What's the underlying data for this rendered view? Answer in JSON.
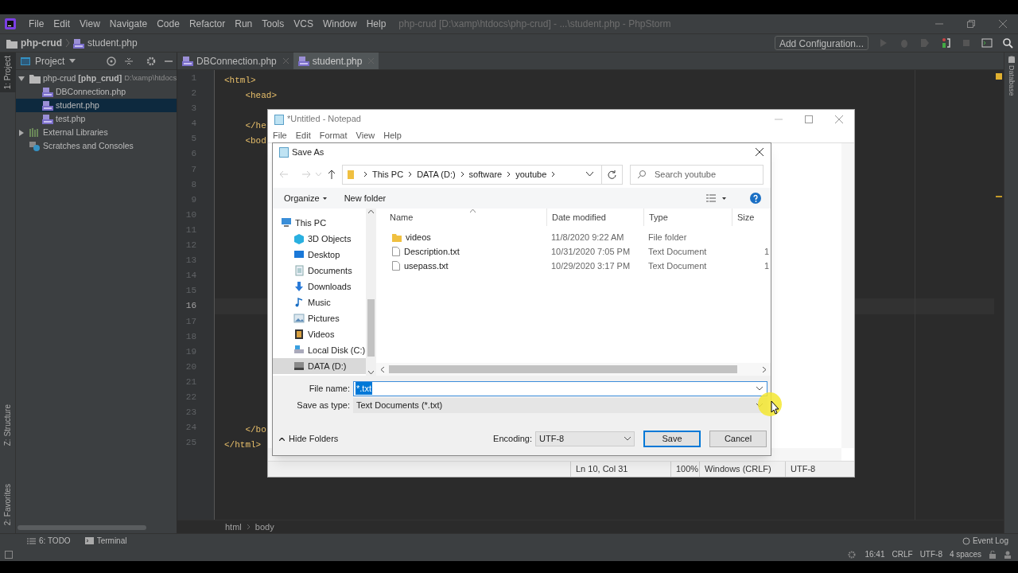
{
  "ide": {
    "menu": [
      "File",
      "Edit",
      "View",
      "Navigate",
      "Code",
      "Refactor",
      "Run",
      "Tools",
      "VCS",
      "Window",
      "Help"
    ],
    "title": "php-crud [D:\\xamp\\htdocs\\php-crud] - ...\\student.php - PhpStorm",
    "breadcrumb": [
      "php-crud",
      "student.php"
    ],
    "run_config": "Add Configuration...",
    "left_tabs": [
      {
        "label": "1: Project",
        "selected": true
      },
      {
        "label": "Z: Structure",
        "selected": false
      },
      {
        "label": "2: Favorites",
        "selected": false
      }
    ],
    "right_tab": "Database",
    "project_header": "Project",
    "tree": [
      {
        "kind": "module",
        "label": "php-crud **[php_crud]**",
        "path": "D:\\xamp\\htdocs",
        "expanded": true,
        "selected": false,
        "children": [
          {
            "kind": "php",
            "label": "DBConnection.php",
            "selected": false
          },
          {
            "kind": "php",
            "label": "student.php",
            "selected": true
          },
          {
            "kind": "php",
            "label": "test.php",
            "selected": false
          }
        ]
      },
      {
        "kind": "libraries",
        "label": "External Libraries",
        "expanded": false,
        "selected": false
      },
      {
        "kind": "scratches",
        "label": "Scratches and Consoles",
        "selected": false
      }
    ],
    "editor_tabs": [
      {
        "label": "DBConnection.php",
        "selected": false
      },
      {
        "label": "student.php",
        "selected": true
      }
    ],
    "lines": [
      {
        "number": "1",
        "code": "<html>",
        "current": false
      },
      {
        "number": "2",
        "code": "    <head>",
        "current": false
      },
      {
        "number": "3",
        "current": false
      },
      {
        "number": "4",
        "code": "    </he",
        "current": false
      },
      {
        "number": "5",
        "code": "    <bod",
        "current": false
      },
      {
        "number": "6",
        "current": false
      },
      {
        "number": "7",
        "current": false
      },
      {
        "number": "8",
        "current": false
      },
      {
        "number": "9",
        "current": false
      },
      {
        "number": "10",
        "current": false
      },
      {
        "number": "11",
        "current": false
      },
      {
        "number": "12",
        "current": false
      },
      {
        "number": "13",
        "current": false
      },
      {
        "number": "14",
        "current": false
      },
      {
        "number": "15",
        "current": false
      },
      {
        "number": "16",
        "current": true
      },
      {
        "number": "17",
        "current": false
      },
      {
        "number": "18",
        "current": false
      },
      {
        "number": "19",
        "current": false
      },
      {
        "number": "20",
        "current": false
      },
      {
        "number": "21",
        "current": false
      },
      {
        "number": "22",
        "current": false
      },
      {
        "number": "23",
        "current": false
      },
      {
        "number": "24",
        "code": "    </bo",
        "current": false
      },
      {
        "number": "25",
        "code": "</html>",
        "current": false
      }
    ],
    "editor_breadcrumb": [
      "html",
      "body"
    ],
    "tool_tabs": [
      "6: TODO",
      "Terminal"
    ],
    "event_log": "Event Log",
    "status": [
      "16:41",
      "CRLF",
      "UTF-8",
      "4 spaces"
    ]
  },
  "notepad": {
    "title": "*Untitled - Notepad",
    "menu": [
      "File",
      "Edit",
      "Format",
      "View",
      "Help"
    ],
    "status": [
      "Ln 10, Col 31",
      "100%",
      "Windows (CRLF)",
      "UTF-8"
    ]
  },
  "save_as": {
    "title": "Save As",
    "path": [
      "This PC",
      "DATA (D:)",
      "software",
      "youtube"
    ],
    "search": {
      "placeholder": "Search youtube"
    },
    "toolbar": [
      "Organize",
      "New folder"
    ],
    "nav": [
      {
        "kind": "pc",
        "label": "This PC",
        "selected": false
      },
      {
        "kind": "cube",
        "label": "3D Objects",
        "selected": false
      },
      {
        "kind": "desktop",
        "label": "Desktop",
        "selected": false
      },
      {
        "kind": "documents",
        "label": "Documents",
        "selected": false
      },
      {
        "kind": "downloads",
        "label": "Downloads",
        "selected": false
      },
      {
        "kind": "music",
        "label": "Music",
        "selected": false
      },
      {
        "kind": "pictures",
        "label": "Pictures",
        "selected": false
      },
      {
        "kind": "videos",
        "label": "Videos",
        "selected": false
      },
      {
        "kind": "disk",
        "label": "Local Disk (C:)",
        "selected": false
      },
      {
        "kind": "drive",
        "label": "DATA (D:)",
        "selected": true
      }
    ],
    "columns": [
      "Name",
      "Date modified",
      "Type",
      "Size"
    ],
    "files": [
      {
        "kind": "folder",
        "name": "videos",
        "date": "11/8/2020 9:22 AM",
        "type": "File folder"
      },
      {
        "kind": "file",
        "name": "Description.txt",
        "date": "10/31/2020 7:05 PM",
        "type": "Text Document",
        "size": "1"
      },
      {
        "kind": "file",
        "name": "usepass.txt",
        "date": "10/29/2020 3:17 PM",
        "type": "Text Document",
        "size": "1"
      }
    ],
    "file_name": {
      "label": "File name:",
      "value": "*.txt"
    },
    "save_type": {
      "label": "Save as type:",
      "value": "Text Documents (*.txt)"
    },
    "hide_folders": "Hide Folders",
    "encoding": {
      "label": "Encoding:",
      "value": "UTF-8"
    },
    "buttons": [
      "Save",
      "Cancel"
    ]
  }
}
